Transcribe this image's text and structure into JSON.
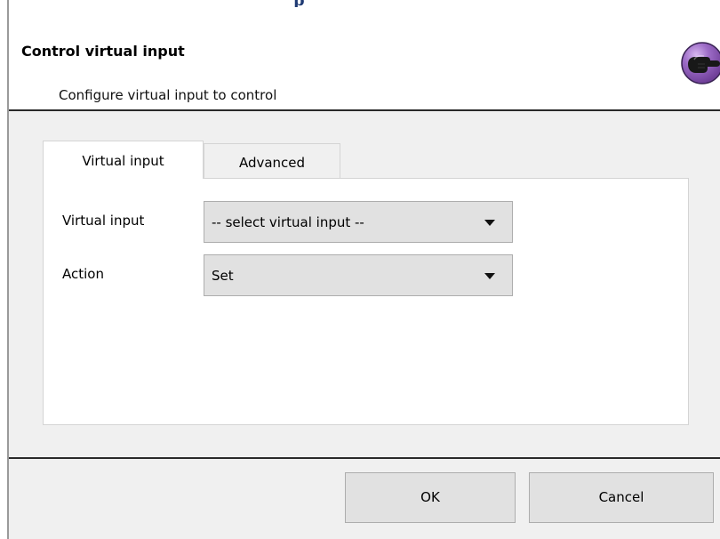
{
  "window": {
    "top_fragment": "p"
  },
  "header": {
    "title": "Control virtual input",
    "subtitle": "Configure virtual input to control",
    "icon": "pointing-hand-icon"
  },
  "tabs": [
    {
      "label": "Virtual input",
      "active": true
    },
    {
      "label": "Advanced",
      "active": false
    }
  ],
  "form": {
    "virtual_input": {
      "label": "Virtual input",
      "value": "-- select virtual input --"
    },
    "action": {
      "label": "Action",
      "value": "Set"
    }
  },
  "buttons": {
    "ok": "OK",
    "cancel": "Cancel"
  },
  "colors": {
    "dialog_background": "#f0f0f0",
    "header_background": "#ffffff",
    "icon_purple": "#8c57b8",
    "separator": "#2a2a2a"
  }
}
